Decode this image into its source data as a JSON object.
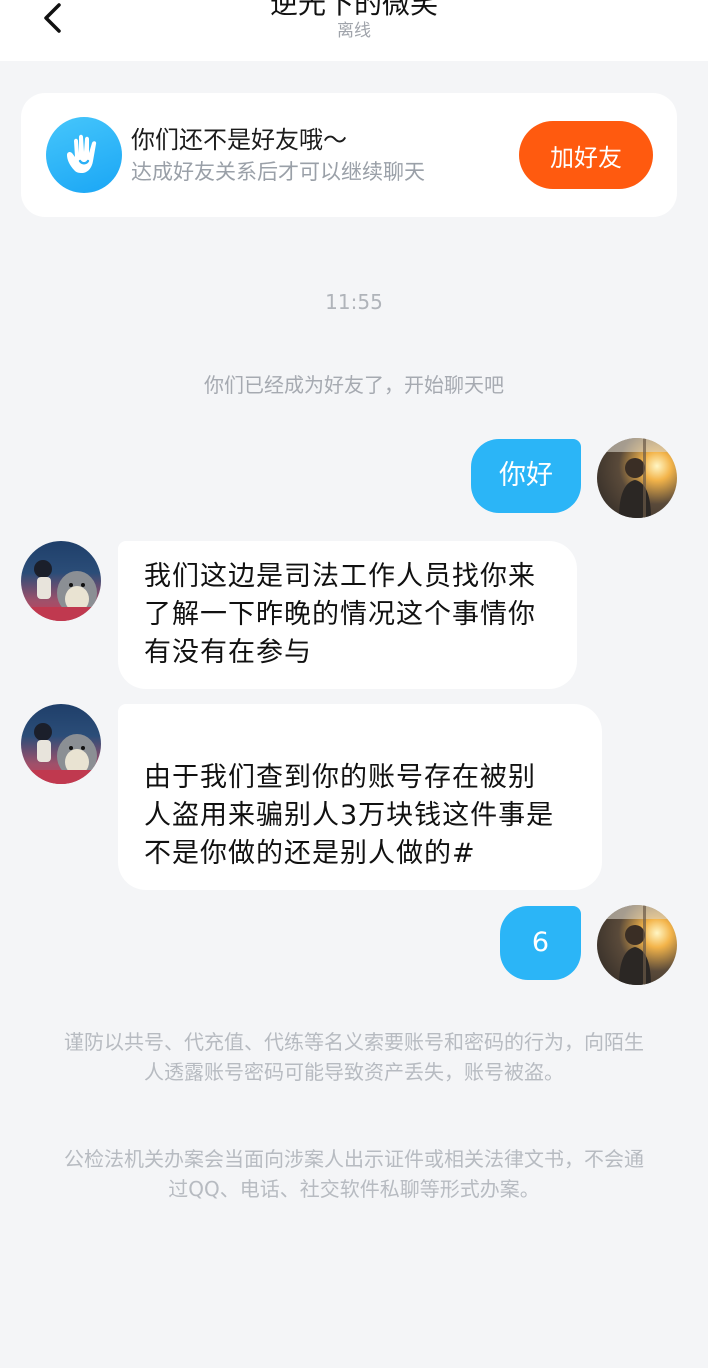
{
  "header": {
    "title": "逆光下的微笑",
    "status": "离线"
  },
  "friend_card": {
    "title": "你们还不是好友哦～",
    "subtitle": "达成好友关系后才可以继续聊天",
    "add_button": "加好友"
  },
  "chat": {
    "timestamp": "11:55",
    "system_message": "你们已经成为好友了，开始聊天吧",
    "messages": [
      {
        "sender": "me",
        "text": "你好"
      },
      {
        "sender": "other",
        "text": "我们这边是司法工作人员找你来了解一下昨晚的情况这个事情你有没有在参与"
      },
      {
        "sender": "other",
        "text": "由于我们查到你的账号存在被别\n人盗用来骗别人3万块钱这件事是不是你做的还是别人做的#"
      },
      {
        "sender": "me",
        "text": "6"
      }
    ]
  },
  "warnings": {
    "line1": "谨防以共号、代充值、代练等名义索要账号和密码的行为，向陌生人透露账号密码可能导致资产丢失，账号被盗。",
    "line2": "公检法机关办案会当面向涉案人出示证件或相关法律文书，不会通过QQ、电话、社交软件私聊等形式办案。"
  },
  "colors": {
    "accent_blue": "#2bb5f7",
    "add_button": "#ff5a0f",
    "background": "#f4f5f7"
  },
  "icons": {
    "back": "chevron-left-icon",
    "hand": "hand-wave-icon"
  }
}
